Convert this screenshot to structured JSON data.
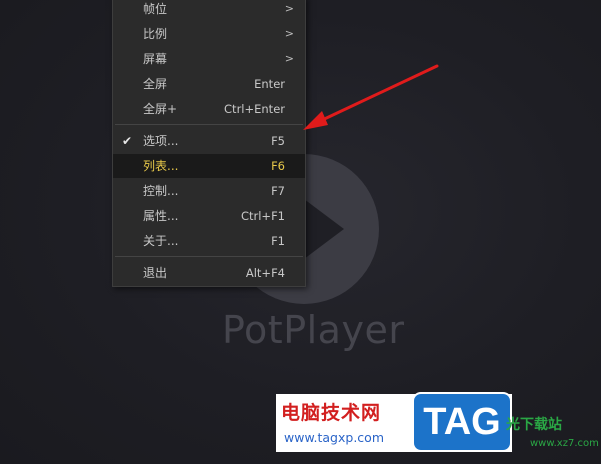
{
  "player": {
    "brand": "PotPlayer"
  },
  "menu": {
    "items": [
      {
        "label": "帧位",
        "shortcut": "",
        "submenu": true,
        "checked": false
      },
      {
        "label": "比例",
        "shortcut": "",
        "submenu": true,
        "checked": false
      },
      {
        "label": "屏幕",
        "shortcut": "",
        "submenu": true,
        "checked": false
      },
      {
        "label": "全屏",
        "shortcut": "Enter",
        "submenu": false,
        "checked": false
      },
      {
        "label": "全屏+",
        "shortcut": "Ctrl+Enter",
        "submenu": false,
        "checked": false
      },
      {
        "label": "选项...",
        "shortcut": "F5",
        "submenu": false,
        "checked": true
      },
      {
        "label": "列表...",
        "shortcut": "F6",
        "submenu": false,
        "checked": false,
        "highlighted": true
      },
      {
        "label": "控制...",
        "shortcut": "F7",
        "submenu": false,
        "checked": false
      },
      {
        "label": "属性...",
        "shortcut": "Ctrl+F1",
        "submenu": false,
        "checked": false
      },
      {
        "label": "关于...",
        "shortcut": "F1",
        "submenu": false,
        "checked": false
      },
      {
        "label": "退出",
        "shortcut": "Alt+F4",
        "submenu": false,
        "checked": false
      }
    ],
    "submenu_glyph": ">",
    "check_glyph": "✔"
  },
  "watermark": {
    "cn_text": "电脑技术网",
    "url": "www.tagxp.com",
    "tag": "TAG",
    "site_name": "光下载站",
    "site_url": "www.xz7.com"
  },
  "colors": {
    "menu_bg": "#2b2b2b",
    "highlight_text": "#e8c94a",
    "annotation_arrow": "#e01b1b"
  }
}
